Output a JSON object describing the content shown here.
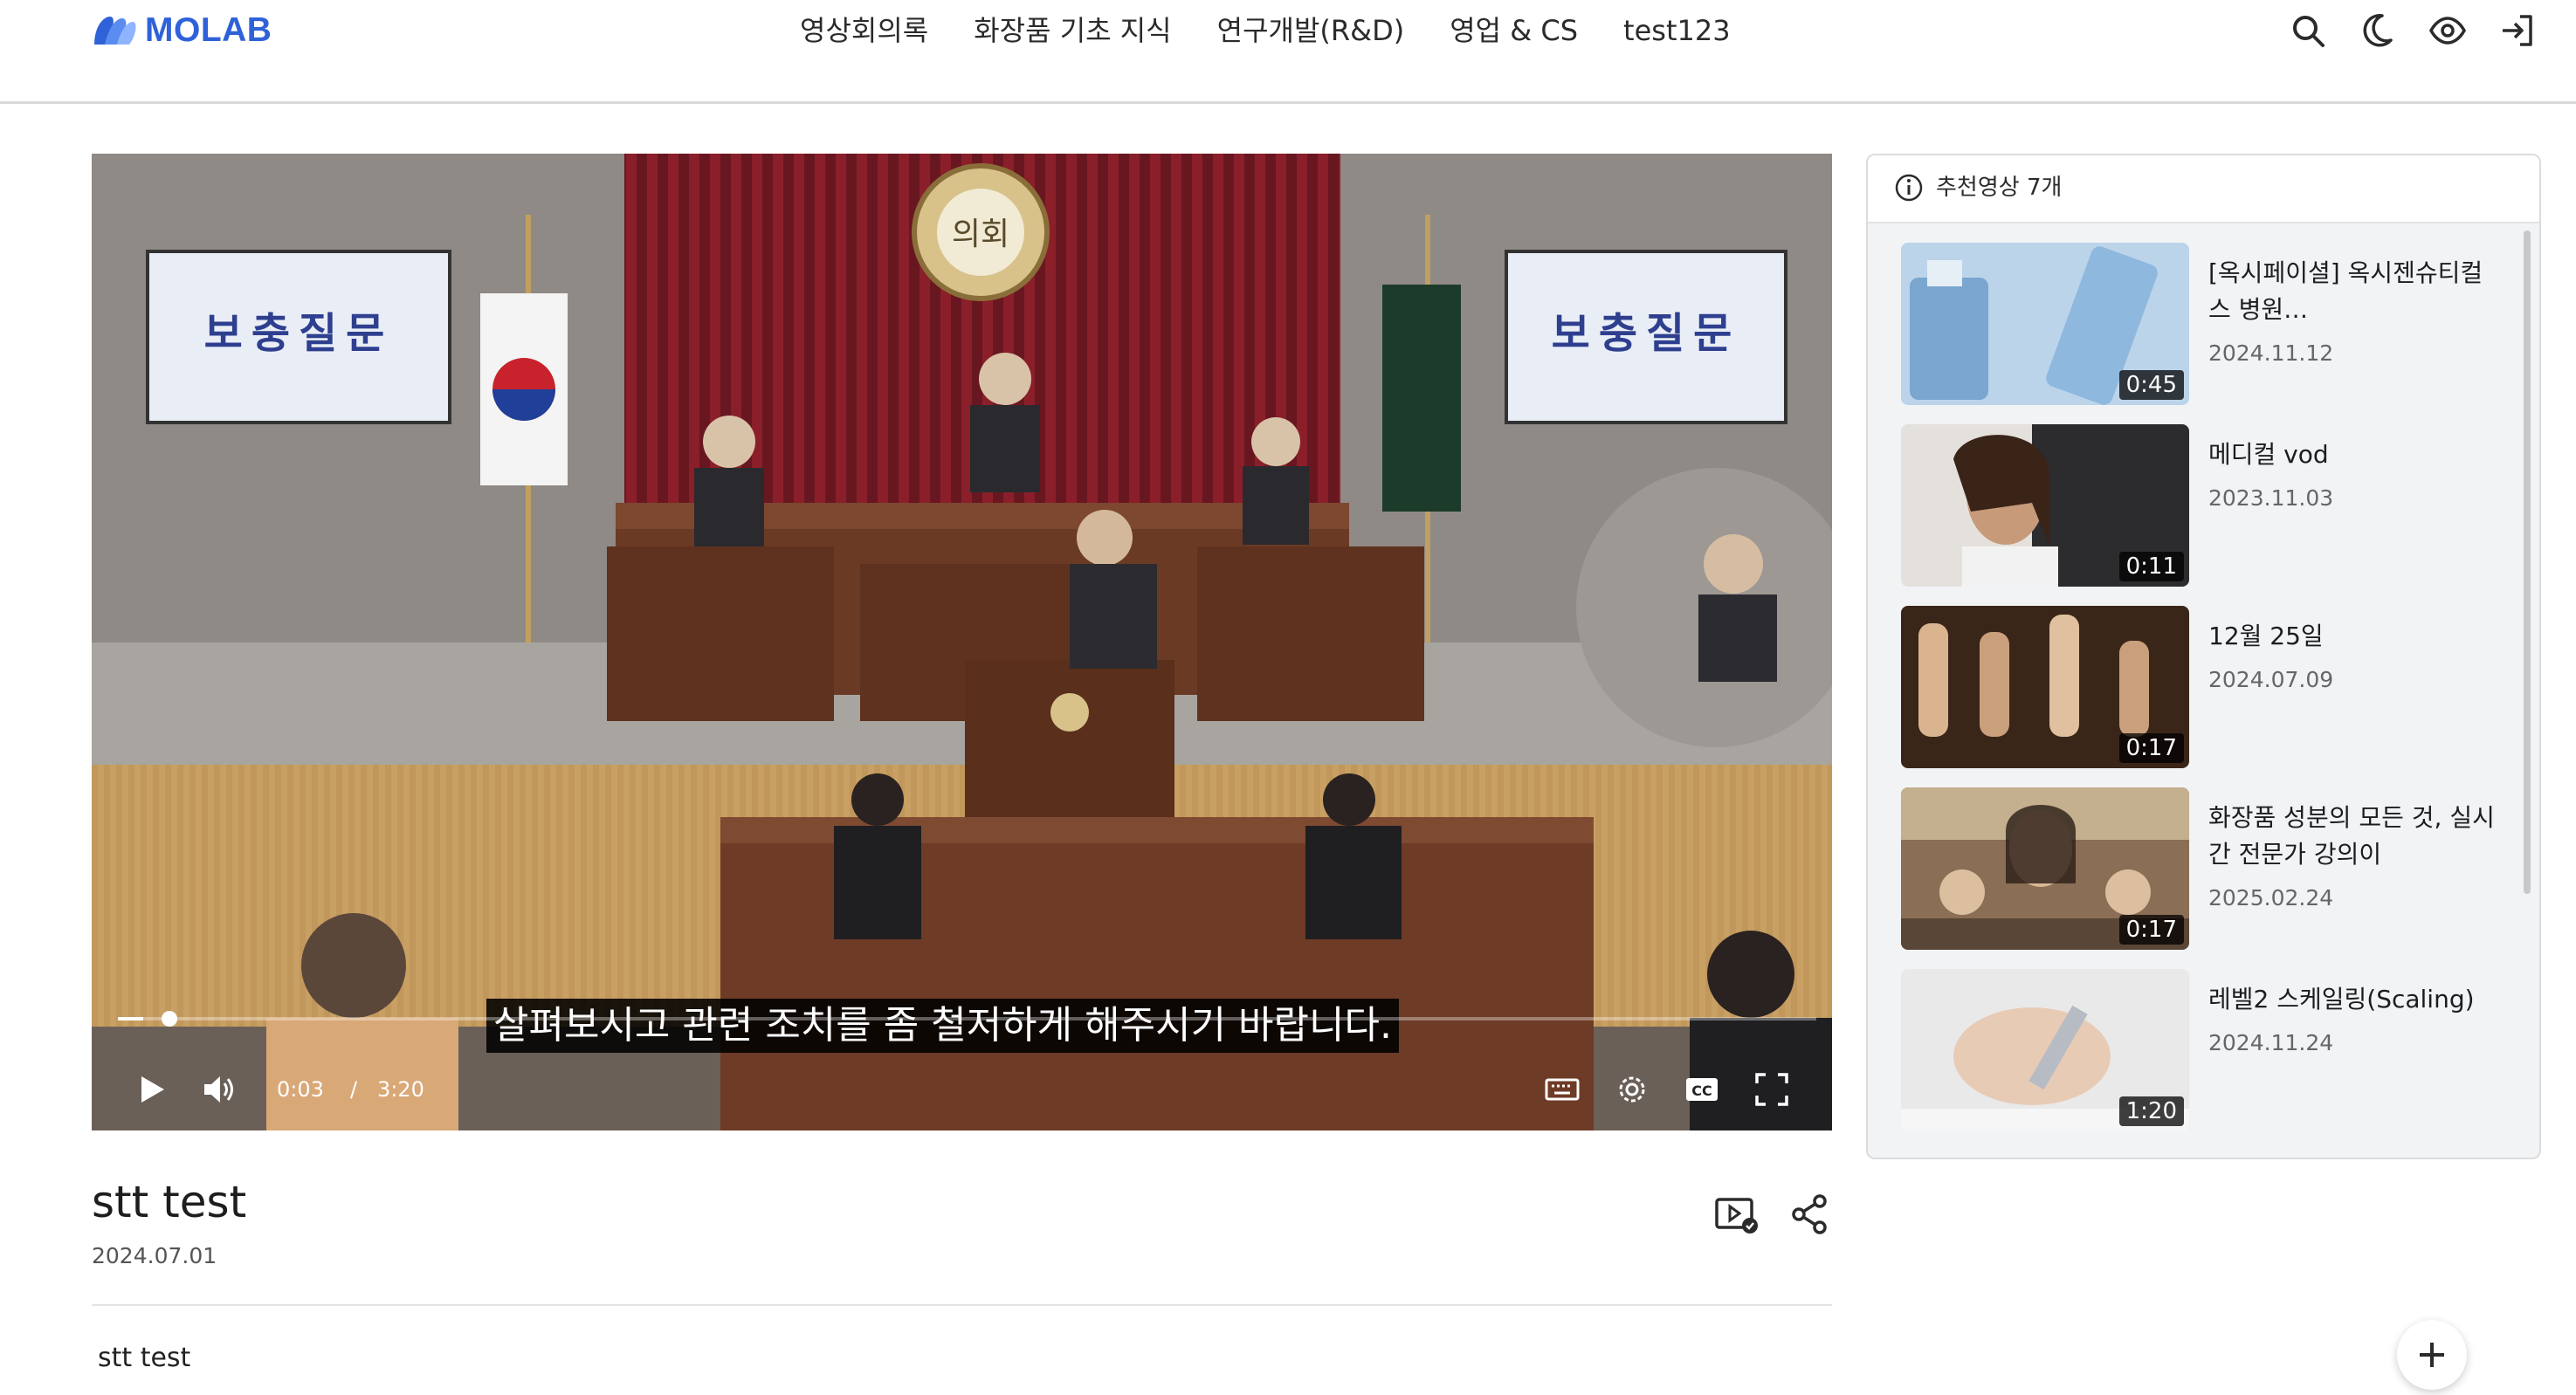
{
  "header": {
    "logo_text": "MOLAB",
    "nav": [
      {
        "label": "영상회의록"
      },
      {
        "label": "화장품 기초 지식"
      },
      {
        "label": "연구개발(R&D)"
      },
      {
        "label": "영업 & CS"
      },
      {
        "label": "test123"
      }
    ],
    "icons": [
      "search-icon",
      "moon-icon",
      "eye-icon",
      "login-icon"
    ]
  },
  "player": {
    "subtitle": "살펴보시고 관련 조치를 좀 철저하게 해주시기 바랍니다.",
    "current_time": "0:03",
    "time_separator": "/",
    "duration": "3:20",
    "progress_fraction": 0.015,
    "scene_signs": [
      "보충질문",
      "보충질문"
    ],
    "emblem_text": "의회"
  },
  "video": {
    "title": "stt test",
    "date": "2024.07.01",
    "description": "stt test"
  },
  "recommendations": {
    "header_label": "추천영상 7개",
    "items": [
      {
        "title": "[옥시페이셜] 옥시젠슈티컬스 병원…",
        "date": "2024.11.12",
        "duration": "0:45"
      },
      {
        "title": "메디컬 vod",
        "date": "2023.11.03",
        "duration": "0:11"
      },
      {
        "title": "12월 25일",
        "date": "2024.07.09",
        "duration": "0:17"
      },
      {
        "title": "화장품 성분의 모든 것, 실시간 전문가 강의이",
        "date": "2025.02.24",
        "duration": "0:17"
      },
      {
        "title": "레벨2 스케일링(Scaling)",
        "date": "2024.11.24",
        "duration": "1:20"
      }
    ]
  },
  "colors": {
    "brand": "#2f62d8",
    "panel_bg": "#f1f3f5"
  }
}
